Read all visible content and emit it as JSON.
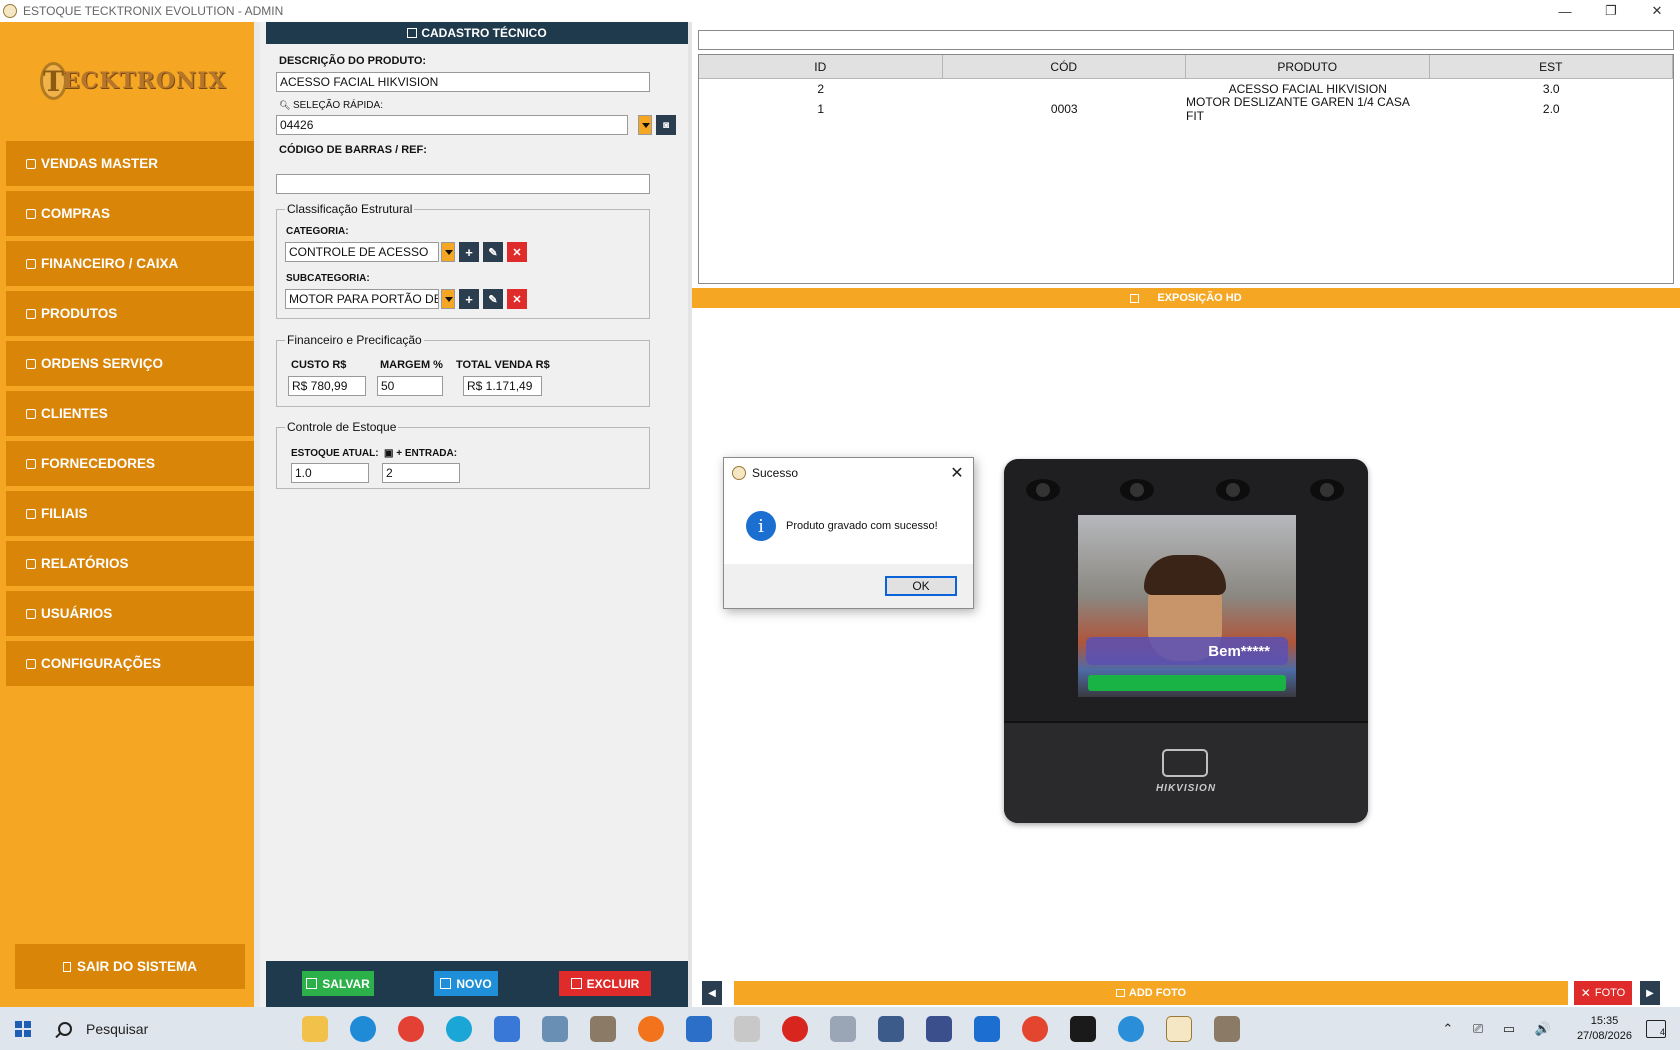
{
  "window": {
    "title": "ESTOQUE TECKTRONIX EVOLUTION - ADMIN",
    "buttons": [
      "—",
      "❐",
      "✕"
    ]
  },
  "sidebar": {
    "logo_initial": "T",
    "logo_text": "ECKTRONIX",
    "items": [
      {
        "label": "VENDAS MASTER",
        "icon": "cart-icon"
      },
      {
        "label": "COMPRAS",
        "icon": "bag-icon"
      },
      {
        "label": "FINANCEIRO / CAIXA",
        "icon": "money-icon"
      },
      {
        "label": "PRODUTOS",
        "icon": "box-icon"
      },
      {
        "label": "ORDENS SERVIÇO",
        "icon": "wrench-icon"
      },
      {
        "label": "CLIENTES",
        "icon": "users-icon"
      },
      {
        "label": "FORNECEDORES",
        "icon": "truck-icon"
      },
      {
        "label": "FILIAIS",
        "icon": "building-icon"
      },
      {
        "label": "RELATÓRIOS",
        "icon": "chart-icon"
      },
      {
        "label": "USUÁRIOS",
        "icon": "user-icon"
      },
      {
        "label": "CONFIGURAÇÕES",
        "icon": "gear-icon"
      }
    ],
    "exit_label": "SAIR DO SISTEMA"
  },
  "form": {
    "header": "CADASTRO TÉCNICO",
    "description_label": "DESCRIÇÃO DO PRODUTO:",
    "description_value": "ACESSO FACIAL HIKVISION",
    "quick_select_label": "SELEÇÃO RÁPIDA:",
    "quick_select_value": "04426",
    "barcode_label": "CÓDIGO DE BARRAS / REF:",
    "barcode_value": "",
    "classification": {
      "legend": "Classificação Estrutural",
      "category_label": "CATEGORIA:",
      "category_value": "CONTROLE DE ACESSO",
      "subcategory_label": "SUBCATEGORIA:",
      "subcategory_value": "MOTOR PARA PORTÃO DESI"
    },
    "finance": {
      "legend": "Financeiro e Precificação",
      "cost_label": "CUSTO R$",
      "cost_value": "R$ 780,99",
      "margin_label": "MARGEM %",
      "margin_value": "50",
      "total_label": "TOTAL VENDA R$",
      "total_value": "R$ 1.171,49"
    },
    "stock": {
      "legend": "Controle de Estoque",
      "current_label": "ESTOQUE ATUAL:",
      "current_value": "1.0",
      "entry_label": "+ ENTRADA:",
      "entry_value": "2"
    },
    "footer": {
      "save": "SALVAR",
      "new": "NOVO",
      "delete": "EXCLUIR"
    },
    "mini_buttons": {
      "add": "+",
      "edit": "✎",
      "remove": "✕"
    }
  },
  "table": {
    "columns": [
      "ID",
      "CÓD",
      "PRODUTO",
      "EST"
    ],
    "rows": [
      [
        "2",
        "",
        "ACESSO FACIAL HIKVISION",
        "3.0"
      ],
      [
        "1",
        "0003",
        "MOTOR DESLIZANTE GAREN 1/4 CASA FIT",
        "2.0"
      ]
    ]
  },
  "photo": {
    "header": "EXPOSIÇÃO HD",
    "device_brand": "HIKVISION",
    "device_banner": "Bem*****",
    "add_photo": "ADD FOTO",
    "delete_photo": "FOTO",
    "prev": "◀",
    "next": "▶"
  },
  "dialog": {
    "title": "Sucesso",
    "message": "Produto gravado com sucesso!",
    "ok": "OK",
    "close": "✕",
    "info_glyph": "i"
  },
  "taskbar": {
    "search_placeholder": "Pesquisar",
    "time": "15:35",
    "date": "27/08/2026",
    "notification_count": "4",
    "tray_glyphs": "⌃ ⎚ ▭ 🔊"
  },
  "colors": {
    "accent": "#f5a623",
    "sidebar_button": "#d98508",
    "header_dark": "#1f3a4d",
    "save_green": "#2bb04a",
    "new_blue": "#1e8fd8",
    "delete_red": "#e02b2b"
  }
}
